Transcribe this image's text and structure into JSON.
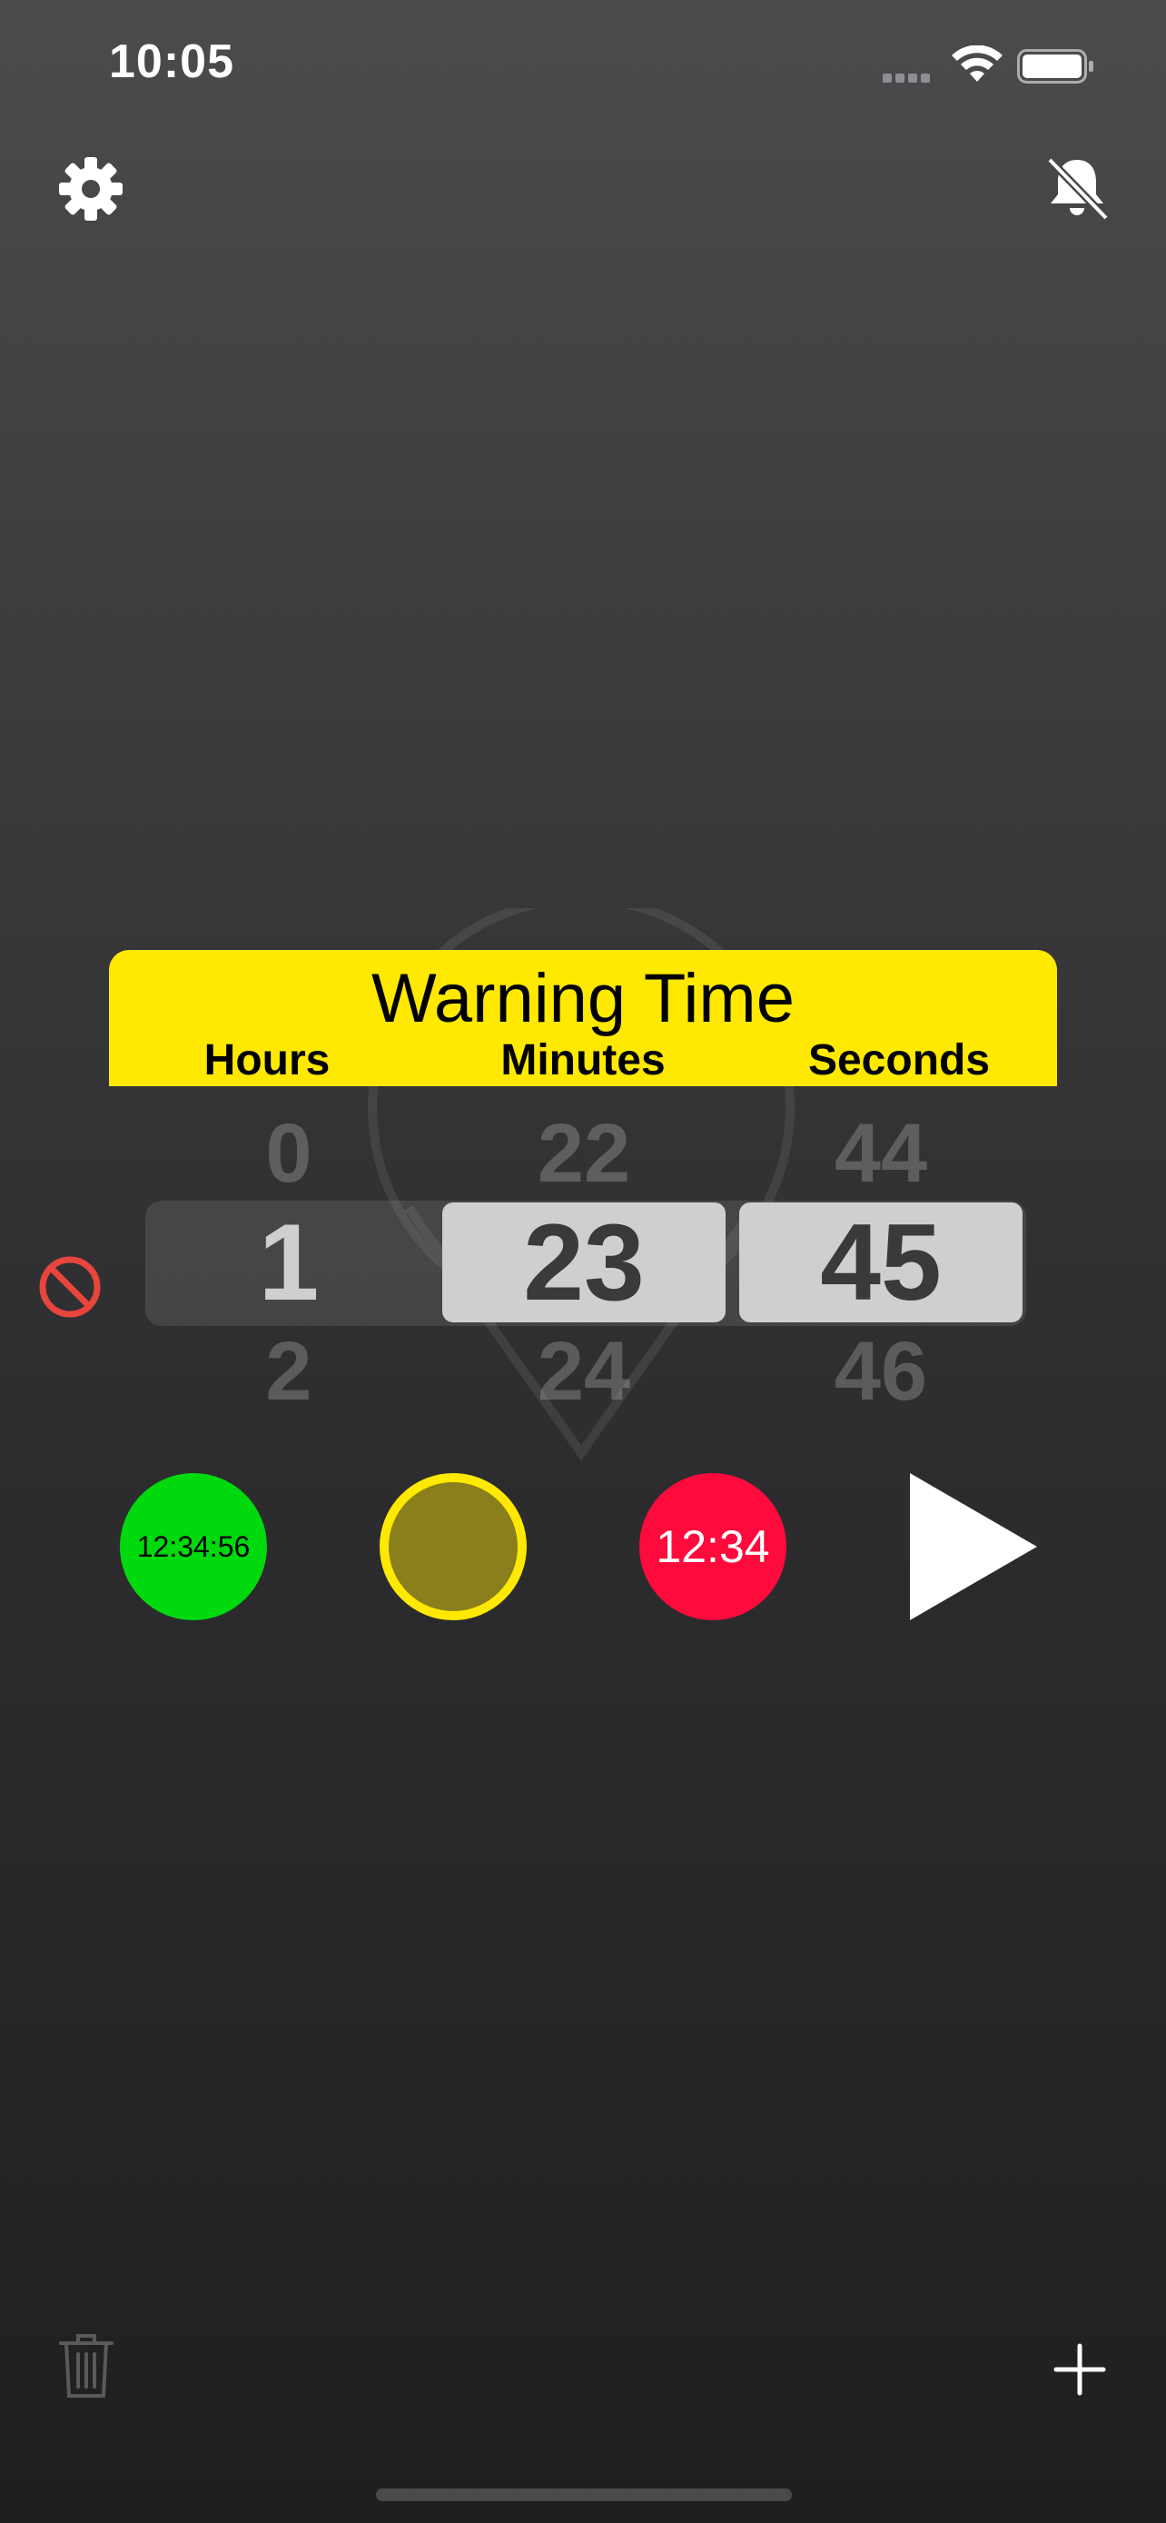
{
  "status_bar": {
    "time": "10:05"
  },
  "icons": {
    "settings": "gear-icon",
    "alerts_muted": "bell-slash-icon",
    "disable": "prohibit-icon",
    "delete": "trash-icon",
    "add": "plus-icon",
    "start": "play-icon"
  },
  "panel": {
    "title": "Warning Time",
    "columns": {
      "hours": "Hours",
      "minutes": "Minutes",
      "seconds": "Seconds"
    }
  },
  "picker": {
    "hours": {
      "above": "0",
      "selected": "1",
      "below": "2"
    },
    "minutes": {
      "above": "22",
      "selected": "23",
      "below": "24"
    },
    "seconds": {
      "above": "44",
      "selected": "45",
      "below": "46"
    }
  },
  "phases": {
    "green_label": "12:34:56",
    "red_label": "12:34"
  },
  "colors": {
    "warning_yellow": "#FFE900",
    "green": "#00D90D",
    "red": "#FF0A3C",
    "prohibit_red": "#E8453C"
  }
}
